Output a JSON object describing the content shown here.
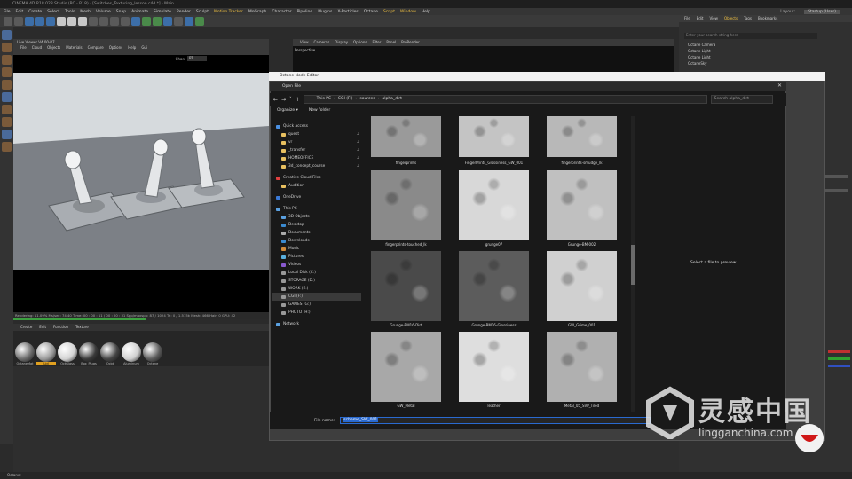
{
  "app": {
    "title": "CINEMA 4D R18.028 Studio (RC - R18) - [Switches_Texturing_lesson.c4d *] - Main",
    "menu": [
      "File",
      "Edit",
      "Create",
      "Select",
      "Tools",
      "Mesh",
      "Volume",
      "Snap",
      "Animate",
      "Simulate",
      "Render",
      "Sculpt",
      "Motion Tracker",
      "MoGraph",
      "Character",
      "Pipeline",
      "Plugins",
      "X-Particles",
      "Octane",
      "Script",
      "Window",
      "Help"
    ],
    "menu_highlight": [
      "Motion Tracker",
      "Script",
      "Window"
    ],
    "layout_label": "Layout:",
    "layout_value": "Startup (User)"
  },
  "viewer": {
    "title": "Live Viewer V4.00-R7",
    "menu": [
      "File",
      "Cloud",
      "Objects",
      "Materials",
      "Compare",
      "Options",
      "Help",
      "Gui"
    ],
    "channel": "Chan",
    "channel_value": "PT",
    "status": "Rendering: 11.09%   Ms/sec: 74.40   Time: 00 : 00 : 11 / 00 : 00 : 31   Spp/maxspp: 87 / 1024   Tri: 0 / 1.515k   Mesh: 466   Hair: 0   GPU: 42"
  },
  "material_manager": {
    "tabs": [
      "Create",
      "Edit",
      "Function",
      "Texture"
    ],
    "labels": [
      "OctaneMat",
      "Lid",
      "OctGlass",
      "Box_Plugs",
      "Ocbt",
      "Aluminum",
      "Octane"
    ],
    "selected_label": "Lid"
  },
  "mid_viewport": {
    "menu": [
      "View",
      "Cameras",
      "Display",
      "Options",
      "Filter",
      "Panel",
      "ProRender"
    ],
    "label": "Perspective"
  },
  "object_manager": {
    "menu": [
      "File",
      "Edit",
      "View",
      "Objects",
      "Tags",
      "Bookmarks"
    ],
    "highlight": "Objects",
    "search_placeholder": "Enter your search string here",
    "objects": [
      "Octane Camera",
      "Octane Light",
      "Octane Light",
      "OctaneSky"
    ]
  },
  "node_editor": {
    "title": "Octane Node Editor"
  },
  "open_dialog": {
    "title": "Open File",
    "close": "✕",
    "breadcrumb": [
      "This PC",
      "CGI (F:)",
      "sources",
      "alpha_dirt"
    ],
    "search_placeholder": "Search alpha_dirt",
    "organize": "Organize ▾",
    "new_folder": "New folder",
    "nav": [
      {
        "label": "Quick access",
        "icon": "star-icon",
        "pin": false,
        "indent": false
      },
      {
        "label": "quest",
        "icon": "folder-icon",
        "pin": true,
        "indent": true
      },
      {
        "label": "vr",
        "icon": "folder-icon",
        "pin": true,
        "indent": true
      },
      {
        "label": "_transfer",
        "icon": "folder-icon",
        "pin": true,
        "indent": true
      },
      {
        "label": "HOMEOFFICE",
        "icon": "folder-icon",
        "pin": true,
        "indent": true
      },
      {
        "label": "3d_concept_course",
        "icon": "folder-icon",
        "pin": true,
        "indent": true
      },
      {
        "label": "Creative Cloud Files",
        "icon": "cloud-icon",
        "pin": false,
        "indent": false
      },
      {
        "label": "Audition",
        "icon": "folder-icon",
        "pin": false,
        "indent": true
      },
      {
        "label": "OneDrive",
        "icon": "onedrive-icon",
        "pin": false,
        "indent": false
      },
      {
        "label": "This PC",
        "icon": "pc-icon",
        "pin": false,
        "indent": false
      },
      {
        "label": "3D Objects",
        "icon": "cube-icon",
        "pin": false,
        "indent": true
      },
      {
        "label": "Desktop",
        "icon": "desktop-icon",
        "pin": false,
        "indent": true
      },
      {
        "label": "Documents",
        "icon": "document-icon",
        "pin": false,
        "indent": true
      },
      {
        "label": "Downloads",
        "icon": "download-icon",
        "pin": false,
        "indent": true
      },
      {
        "label": "Music",
        "icon": "music-icon",
        "pin": false,
        "indent": true
      },
      {
        "label": "Pictures",
        "icon": "picture-icon",
        "pin": false,
        "indent": true
      },
      {
        "label": "Videos",
        "icon": "video-icon",
        "pin": false,
        "indent": true
      },
      {
        "label": "Local Disk (C:)",
        "icon": "drive-icon",
        "pin": false,
        "indent": true
      },
      {
        "label": "STORAGE (D:)",
        "icon": "drive-icon",
        "pin": false,
        "indent": true
      },
      {
        "label": "WORK (E:)",
        "icon": "drive-icon",
        "pin": false,
        "indent": true
      },
      {
        "label": "CGI (F:)",
        "icon": "drive-icon",
        "pin": false,
        "indent": true,
        "selected": true
      },
      {
        "label": "GAMES (G:)",
        "icon": "drive-icon",
        "pin": false,
        "indent": true
      },
      {
        "label": "PHOTO (H:)",
        "icon": "drive-icon",
        "pin": false,
        "indent": true
      },
      {
        "label": "Network",
        "icon": "network-icon",
        "pin": false,
        "indent": false
      }
    ],
    "files": [
      {
        "name": "fingerprints",
        "tone": "#9a9a9a"
      },
      {
        "name": "FingerPrints_Glossiness_GW_001",
        "tone": "#c4c4c4"
      },
      {
        "name": "fingerprints-smudge_lk",
        "tone": "#b8b8b8"
      },
      {
        "name": "fingerprints-touched_lk",
        "tone": "#8a8a8a"
      },
      {
        "name": "grunge07",
        "tone": "#d8d8d8"
      },
      {
        "name": "Grunge-BM-002",
        "tone": "#c0c0c0"
      },
      {
        "name": "Grunge-BM16-Dirt",
        "tone": "#4a4a4a"
      },
      {
        "name": "Grunge-BM16-Glossiness",
        "tone": "#5c5c5c"
      },
      {
        "name": "GW_Grime_001",
        "tone": "#d0d0d0"
      },
      {
        "name": "GW_Metal",
        "tone": "#a8a8a8"
      },
      {
        "name": "leather",
        "tone": "#dedede"
      },
      {
        "name": "Metal_05_SVP_Tiled",
        "tone": "#b0b0b0"
      }
    ],
    "preview_text": "Select a file to preview.",
    "filename_label": "File name:",
    "filename_value": "scheme_SW_001"
  },
  "watermark": {
    "cn": "灵感中国",
    "url": "lingganchina.com"
  },
  "bottom_status": "Octane:"
}
